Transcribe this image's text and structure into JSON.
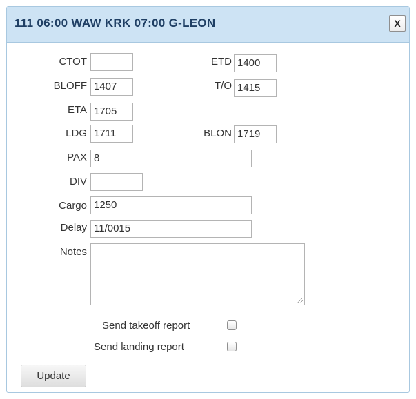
{
  "dialog": {
    "title": "111 06:00 WAW KRK 07:00 G-LEON",
    "close_label": "X"
  },
  "fields": {
    "ctot": {
      "label": "CTOT",
      "value": ""
    },
    "etd": {
      "label": "ETD",
      "value": "1400"
    },
    "bloff": {
      "label": "BLOFF",
      "value": "1407"
    },
    "to": {
      "label": "T/O",
      "value": "1415"
    },
    "eta": {
      "label": "ETA",
      "value": "1705"
    },
    "ldg": {
      "label": "LDG",
      "value": "1711"
    },
    "blon": {
      "label": "BLON",
      "value": "1719"
    },
    "pax": {
      "label": "PAX",
      "value": "8"
    },
    "div": {
      "label": "DIV",
      "value": ""
    },
    "cargo": {
      "label": "Cargo",
      "value": "1250"
    },
    "delay": {
      "label": "Delay",
      "value": "11/0015"
    },
    "notes": {
      "label": "Notes",
      "value": ""
    }
  },
  "checkboxes": {
    "takeoff": {
      "label": "Send takeoff report",
      "checked": false
    },
    "landing": {
      "label": "Send landing report",
      "checked": false
    }
  },
  "actions": {
    "update_label": "Update"
  },
  "colors": {
    "titlebar_bg": "#cde3f4",
    "title_text": "#1f3f64",
    "border": "#a8c8e0"
  }
}
